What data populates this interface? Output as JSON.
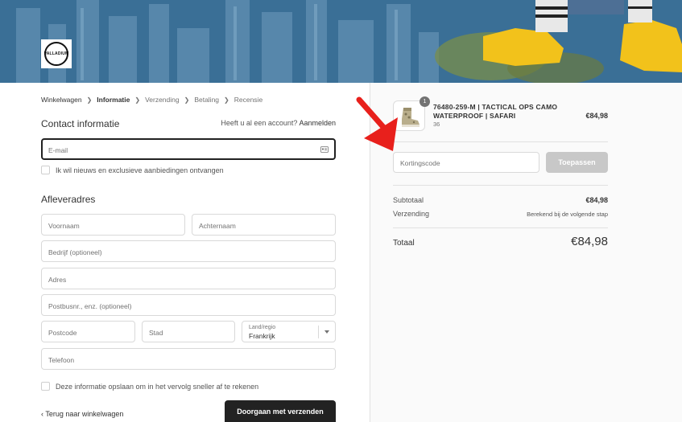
{
  "breadcrumb": [
    "Winkelwagen",
    "Informatie",
    "Verzending",
    "Betaling",
    "Recensie"
  ],
  "contact": {
    "title": "Contact informatie",
    "account_prompt": "Heeft u al een account?",
    "login_link": "Aanmelden",
    "email_placeholder": "E-mail",
    "newsletter_label": "Ik wil nieuws en exclusieve aanbiedingen ontvangen"
  },
  "shipping": {
    "title": "Afleveradres",
    "first_name_placeholder": "Voornaam",
    "last_name_placeholder": "Achternaam",
    "company_placeholder": "Bedrijf (optioneel)",
    "address_placeholder": "Adres",
    "address2_placeholder": "Postbusnr., enz. (optioneel)",
    "postcode_placeholder": "Postcode",
    "city_placeholder": "Stad",
    "country_label": "Land/regio",
    "country_value": "Frankrijk",
    "phone_placeholder": "Telefoon",
    "save_info_label": "Deze informatie opslaan om in het vervolg sneller af te rekenen"
  },
  "nav": {
    "back_label": "Terug naar winkelwagen",
    "continue_label": "Doorgaan met verzenden"
  },
  "logo_text": "PALLADIUM",
  "summary": {
    "quantity": "1",
    "product_name": "76480-259-M | TACTICAL OPS CAMO WATERPROOF | SAFARI",
    "variant": "36",
    "product_price": "€84,98",
    "discount_placeholder": "Kortingscode",
    "apply_label": "Toepassen",
    "subtotal_label": "Subtotaal",
    "subtotal_value": "€84,98",
    "shipping_label": "Verzending",
    "shipping_value": "Berekend bij de volgende stap",
    "total_label": "Totaal",
    "total_value": "€84,98"
  },
  "colors": {
    "annotation_arrow": "#e8201c",
    "button_dark": "#222222",
    "button_disabled": "#c8c8c8"
  }
}
